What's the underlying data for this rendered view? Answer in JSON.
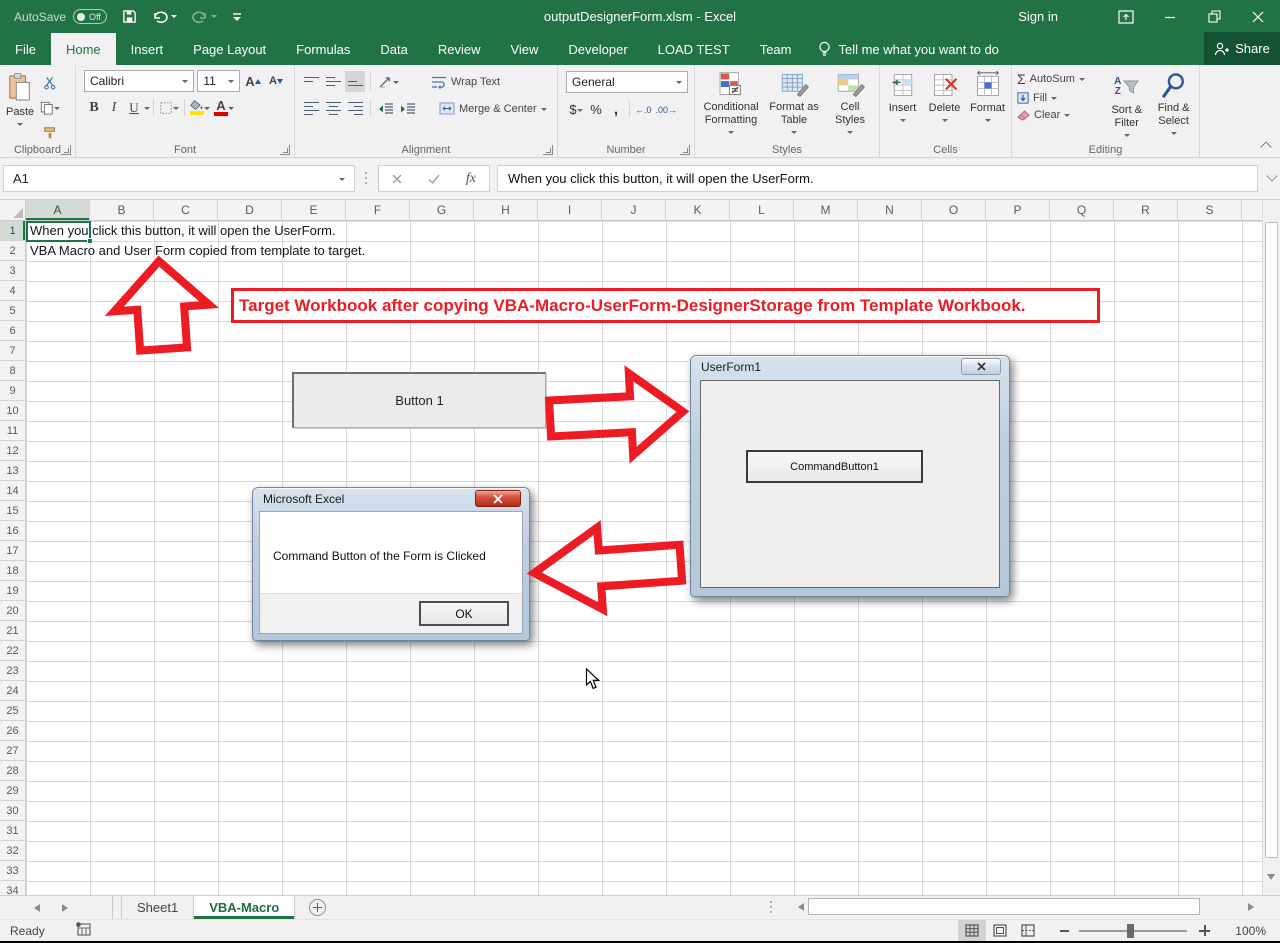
{
  "titlebar": {
    "autosave_label": "AutoSave",
    "autosave_state": "Off",
    "title": "outputDesignerForm.xlsm  -  Excel",
    "sign_in": "Sign in"
  },
  "ribbon": {
    "tabs": [
      "File",
      "Home",
      "Insert",
      "Page Layout",
      "Formulas",
      "Data",
      "Review",
      "View",
      "Developer",
      "LOAD TEST",
      "Team"
    ],
    "active_tab": "Home",
    "tell_me": "Tell me what you want to do",
    "share": "Share",
    "clipboard": {
      "label": "Clipboard",
      "paste": "Paste"
    },
    "font": {
      "label": "Font",
      "family": "Calibri",
      "size": "11",
      "bold": "B",
      "italic": "I",
      "underline": "U",
      "grow": "A",
      "shrink": "A",
      "color_a": "A"
    },
    "alignment": {
      "label": "Alignment",
      "wrap": "Wrap Text",
      "merge": "Merge & Center"
    },
    "number": {
      "label": "Number",
      "format": "General",
      "currency": "$",
      "percent": "%",
      "comma": ",",
      "inc_dec": "←.0",
      "dec_dec": ".00→"
    },
    "styles": {
      "label": "Styles",
      "conditional": "Conditional Formatting",
      "format_table": "Format as Table",
      "cell_styles": "Cell Styles"
    },
    "cells": {
      "label": "Cells",
      "insert": "Insert",
      "delete": "Delete",
      "format": "Format"
    },
    "editing": {
      "label": "Editing",
      "sigma": "Σ",
      "autosum": "AutoSum",
      "fill": "Fill",
      "clear": "Clear",
      "sort_a": "A",
      "sort_z": "Z",
      "sort_filter": "Sort & Filter",
      "find_select": "Find & Select"
    }
  },
  "formula_bar": {
    "name_box": "A1",
    "fx_label": "fx",
    "content": "When you click this button, it will open the UserForm."
  },
  "sheet": {
    "columns": [
      "A",
      "B",
      "C",
      "D",
      "E",
      "F",
      "G",
      "H",
      "I",
      "J",
      "K",
      "L",
      "M",
      "N",
      "O",
      "P",
      "Q",
      "R",
      "S"
    ],
    "rows": [
      "1",
      "2",
      "3",
      "4",
      "5",
      "6",
      "7",
      "8",
      "9",
      "10",
      "11",
      "12",
      "13",
      "14",
      "15",
      "16",
      "17",
      "18",
      "19",
      "20",
      "21",
      "22",
      "23",
      "24",
      "25",
      "26",
      "27",
      "28",
      "29",
      "30",
      "31",
      "32",
      "33",
      "34"
    ],
    "selected_column": "A",
    "selected_row": "1",
    "cell_a1": "When you click this button, it will open the UserForm.",
    "cell_a2": "VBA Macro and User Form copied from template to target.",
    "banner": "Target Workbook after copying VBA-Macro-UserForm-DesignerStorage from Template Workbook.",
    "form_button": "Button 1"
  },
  "userform": {
    "title": "UserForm1",
    "command_button": "CommandButton1"
  },
  "msgbox": {
    "title": "Microsoft Excel",
    "message": "Command Button of the Form is Clicked",
    "ok": "OK"
  },
  "sheet_tabs": [
    {
      "name": "Sheet1",
      "active": false
    },
    {
      "name": "VBA-Macro",
      "active": true
    }
  ],
  "statusbar": {
    "ready": "Ready",
    "zoom": "100%"
  },
  "colors": {
    "excel_green": "#217346",
    "red": "#ed1c24"
  }
}
